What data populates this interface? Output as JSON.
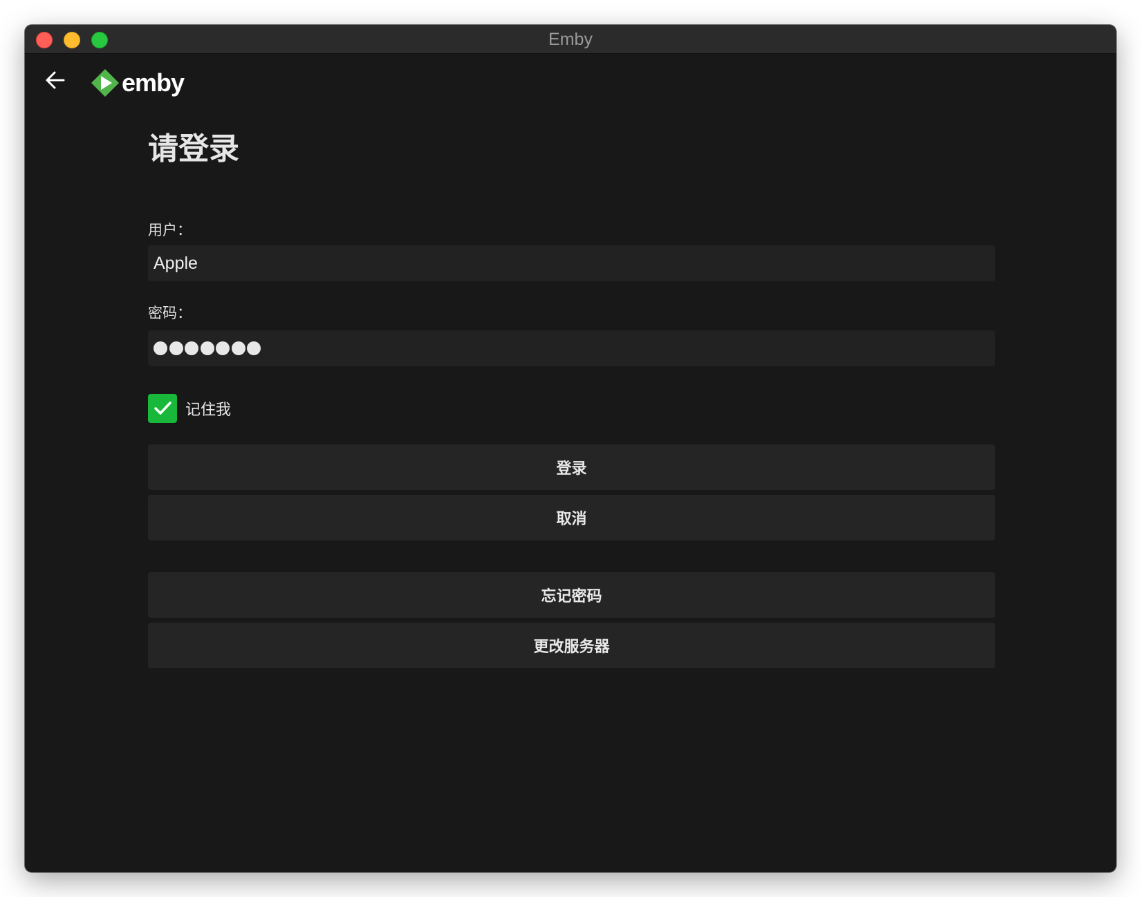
{
  "window": {
    "title": "Emby"
  },
  "header": {
    "logo_text": "emby"
  },
  "login": {
    "title": "请登录",
    "user_label": "用户：",
    "user_value": "Apple",
    "password_label": "密码：",
    "password_mask_count": 7,
    "remember_label": "记住我",
    "remember_checked": true
  },
  "buttons": {
    "login": "登录",
    "cancel": "取消",
    "forgot_password": "忘记密码",
    "change_server": "更改服务器"
  },
  "colors": {
    "accent": "#19b83a",
    "window_bg": "#181818",
    "field_bg": "#222222",
    "button_bg": "#252525"
  }
}
